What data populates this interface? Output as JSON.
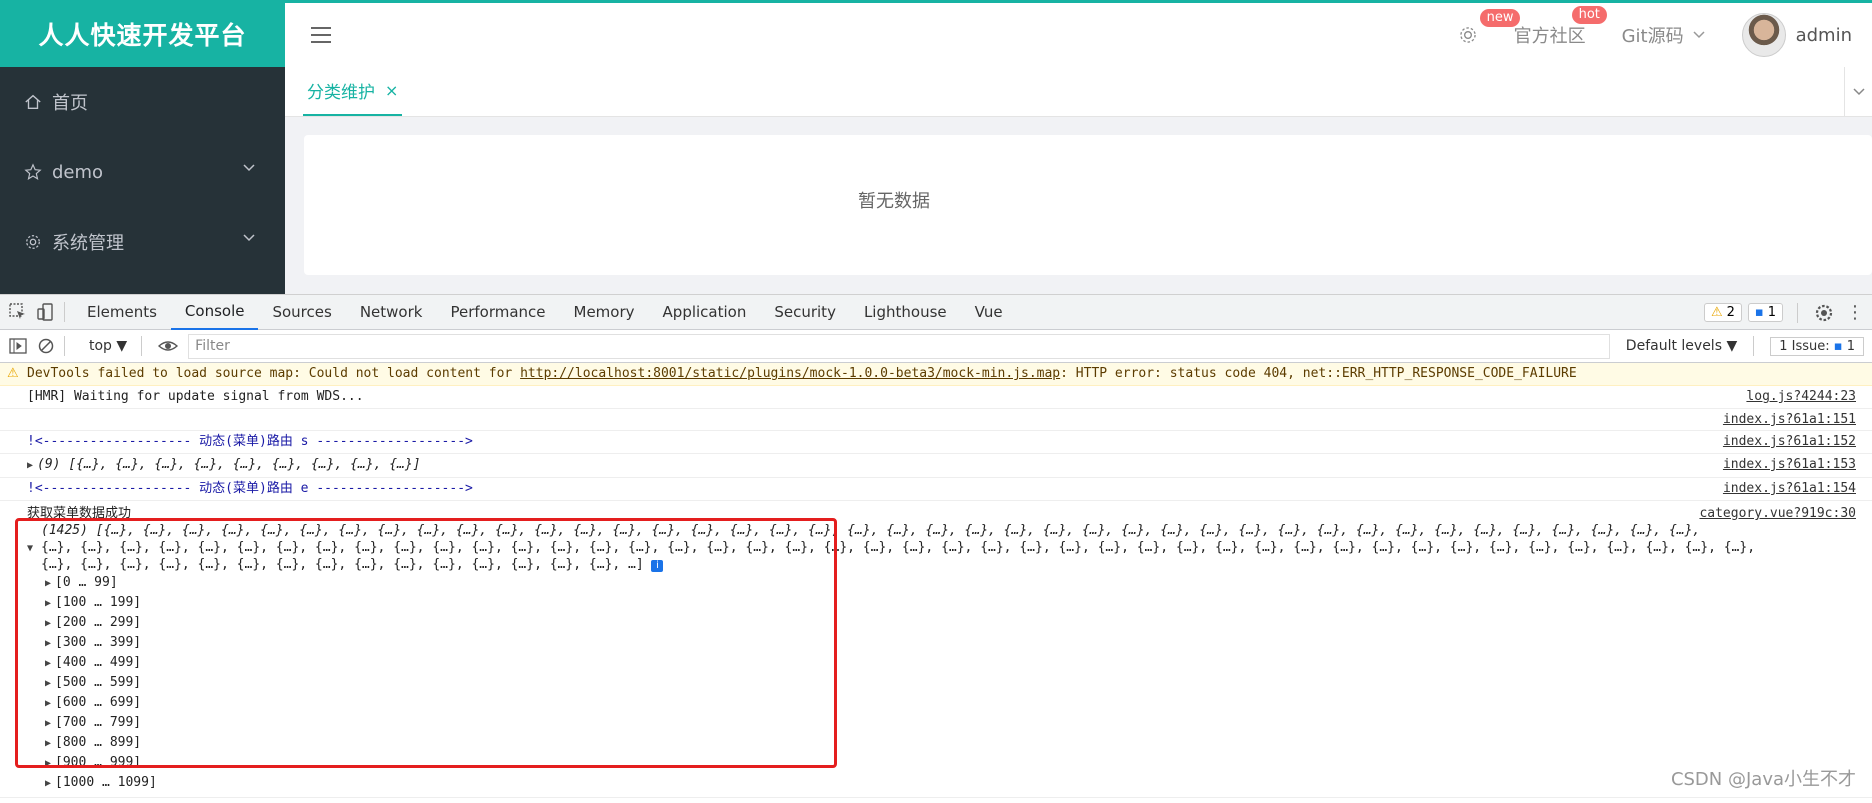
{
  "app": {
    "logo": "人人快速开发平台",
    "nav": {
      "settings_badge": "new",
      "community": "官方社区",
      "community_badge": "hot",
      "git": "Git源码",
      "user": "admin"
    },
    "sidebar": [
      {
        "label": "首页"
      },
      {
        "label": "demo"
      },
      {
        "label": "系统管理"
      }
    ],
    "tab": {
      "label": "分类维护",
      "close": "×"
    },
    "empty_text": "暂无数据",
    "accent": "#17b3a3"
  },
  "devtools": {
    "tabs": [
      "Elements",
      "Console",
      "Sources",
      "Network",
      "Performance",
      "Memory",
      "Application",
      "Security",
      "Lighthouse",
      "Vue"
    ],
    "active_tab": "Console",
    "warn_count": "2",
    "msg_count": "1",
    "context": "top",
    "filter_placeholder": "Filter",
    "levels": "Default levels",
    "issues": "1 Issue:",
    "issues_count": "1"
  },
  "console": {
    "warning": {
      "prefix": "DevTools failed to load source map: Could not load content for ",
      "url": "http://localhost:8001/static/plugins/mock-1.0.0-beta3/mock-min.js.map",
      "suffix": ": HTTP error: status code 404, net::ERR_HTTP_RESPONSE_CODE_FAILURE"
    },
    "rows": [
      {
        "text": "[HMR] Waiting for update signal from WDS...",
        "src": "log.js?4244:23"
      },
      {
        "text": "",
        "src": "index.js?61a1:151"
      },
      {
        "text": "!<------------------- 动态(菜单)路由 s ------------------->",
        "src": "index.js?61a1:152"
      },
      {
        "text": "(9) [{…}, {…}, {…}, {…}, {…}, {…}, {…}, {…}, {…}]",
        "src": "index.js?61a1:153"
      },
      {
        "text": "!<------------------- 动态(菜单)路由 e ------------------->",
        "src": "index.js?61a1:154"
      }
    ],
    "success": {
      "text": "获取菜单数据成功",
      "src": "category.vue?919c:30",
      "array_line1": "(1425) [{…}, {…}, {…}, {…}, {…}, {…}, {…}, {…}, {…}, {…}, {…}, {…}, {…}, {…}, {…}, {…}, {…}, {…}, {…}, {…}, {…}, {…}, {…}, {…}, {…}, {…}, {…}, {…}, {…}, {…}, {…}, {…}, {…}, {…}, {…}, {…}, {…}, {…}, {…}, {…}, {…},",
      "array_line2": "{…}, {…}, {…}, {…}, {…}, {…}, {…}, {…}, {…}, {…}, {…}, {…}, {…}, {…}, {…}, {…}, {…}, {…}, {…}, {…}, {…}, {…}, {…}, {…}, {…}, {…}, {…}, {…}, {…}, {…}, {…}, {…}, {…}, {…}, {…}, {…}, {…}, {…}, {…}, {…}, {…}, {…}, {…}, {…},",
      "array_line3": "{…}, {…}, {…}, {…}, {…}, {…}, {…}, {…}, {…}, {…}, {…}, {…}, {…}, {…}, {…}, …]",
      "info": "i",
      "ranges": [
        "[0 … 99]",
        "[100 … 199]",
        "[200 … 299]",
        "[300 … 399]",
        "[400 … 499]",
        "[500 … 599]",
        "[600 … 699]",
        "[700 … 799]",
        "[800 … 899]",
        "[900 … 999]",
        "[1000 … 1099]"
      ]
    }
  },
  "watermark": "CSDN @Java小生不才"
}
